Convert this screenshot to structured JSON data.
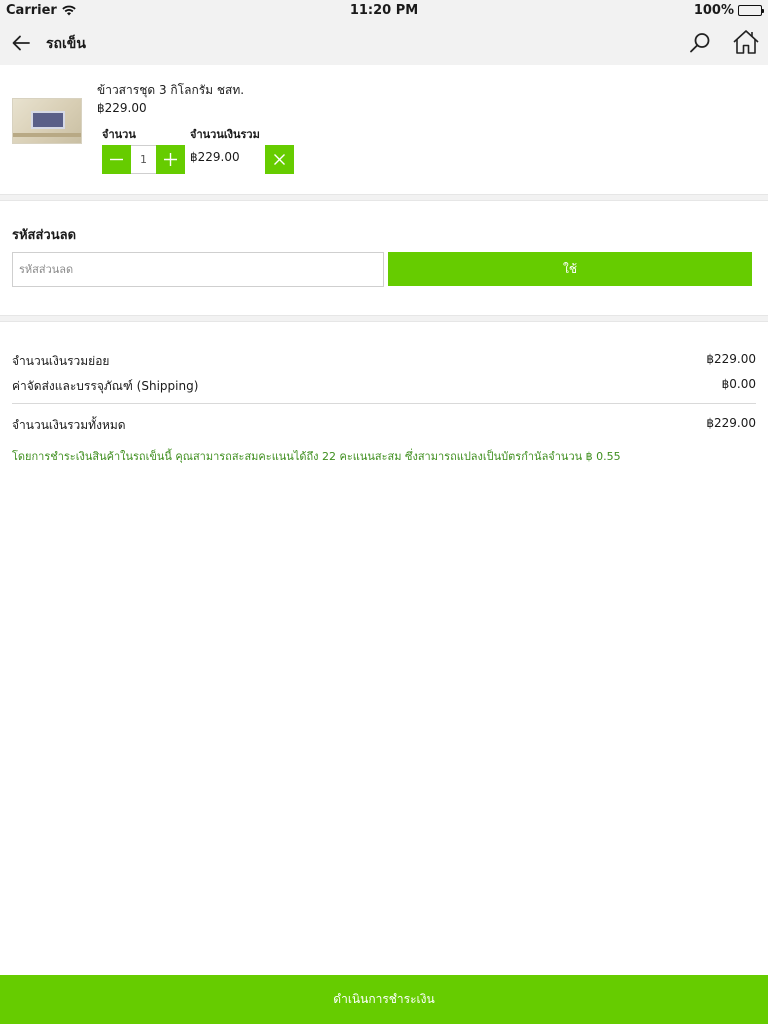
{
  "status_bar": {
    "carrier": "Carrier",
    "time": "11:20 PM",
    "battery": "100%",
    "battery_level": 1.0
  },
  "nav": {
    "title": "รถเข็น",
    "back_icon": "arrow-left-icon",
    "search_icon": "search-icon",
    "home_icon": "home-icon"
  },
  "cart": {
    "items": [
      {
        "name": "ข้าวสารชุด 3 กิโลกรัม ชสท.",
        "price": "฿229.00",
        "quantity_label": "จำนวน",
        "total_label": "จำนวนเงินรวม",
        "quantity": "1",
        "total": "฿229.00"
      }
    ]
  },
  "coupon": {
    "title": "รหัสส่วนลด",
    "placeholder": "รหัสส่วนลด",
    "value": "",
    "apply_label": "ใช้"
  },
  "summary": {
    "subtotal_label": "จำนวนเงินรวมย่อย",
    "subtotal_value": "฿229.00",
    "shipping_label": "ค่าจัดส่งและบรรจุภัณฑ์ (Shipping)",
    "shipping_value": "฿0.00",
    "total_label": "จำนวนเงินรวมทั้งหมด",
    "total_value": "฿229.00",
    "points_note": "โดยการชำระเงินสินค้าในรถเข็นนี้ คุณสามารถสะสมคะแนนได้ถึง 22 คะแนนสะสม ซึ่งสามารถแปลงเป็นบัตรกำนัลจำนวน ฿ 0.55"
  },
  "checkout": {
    "label": "ดำเนินการชำระเงิน"
  },
  "colors": {
    "accent": "#66cc00",
    "note": "#3f8f1f",
    "bar_bg": "#f2f2f2"
  }
}
